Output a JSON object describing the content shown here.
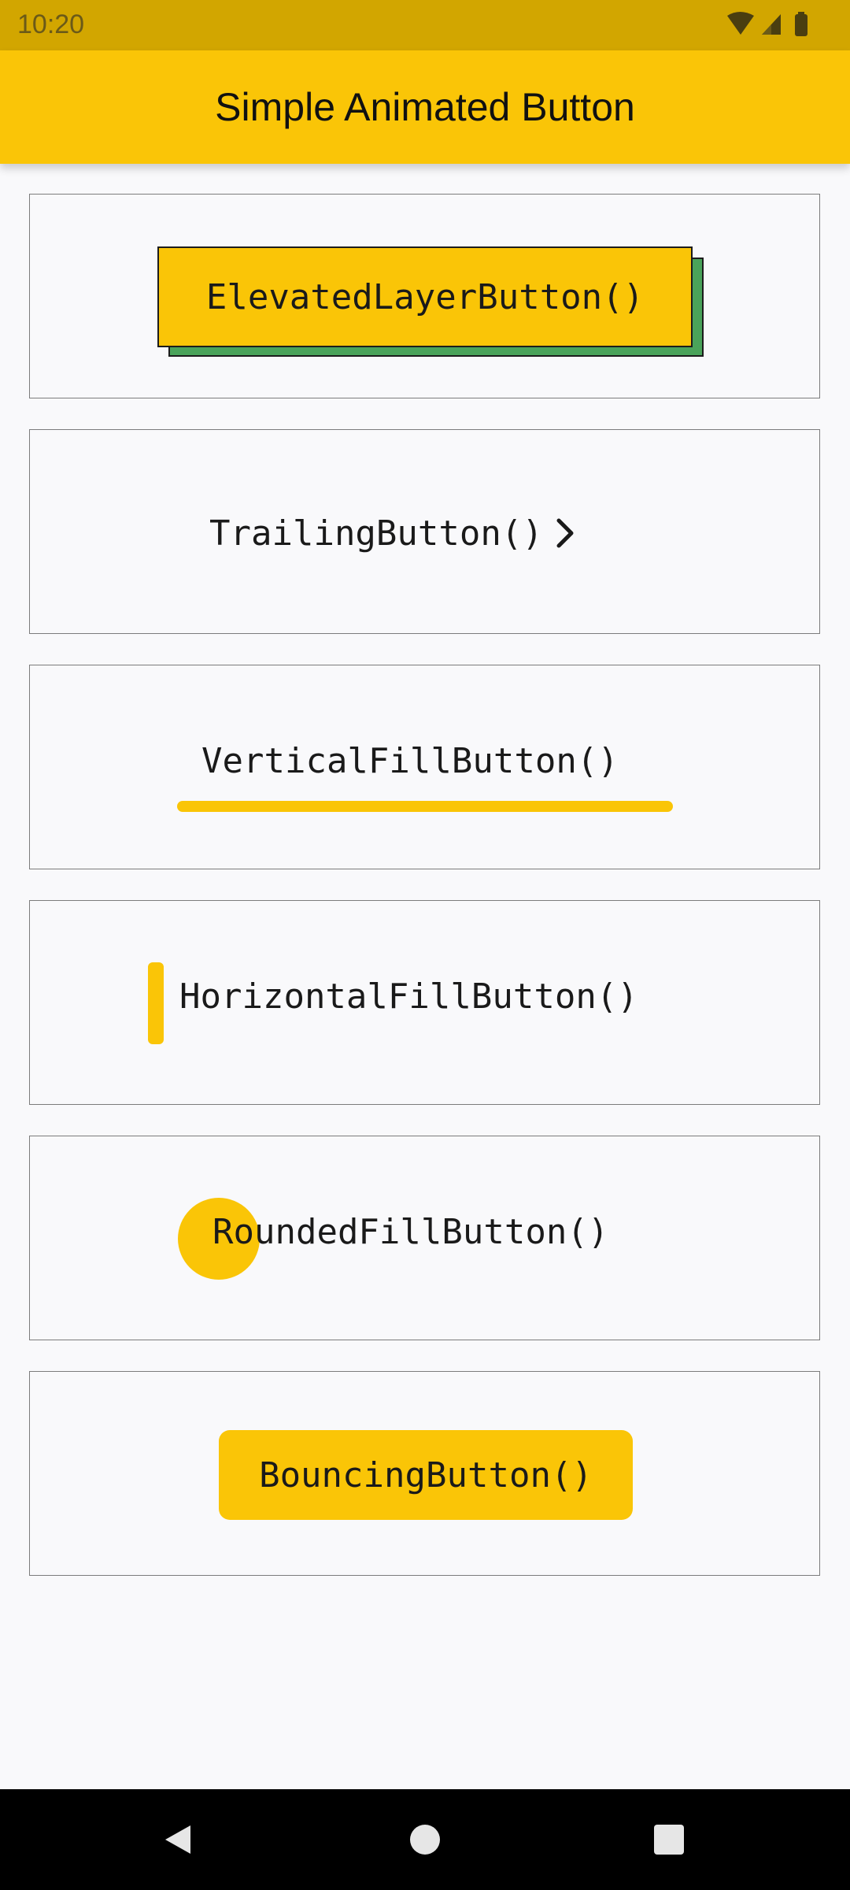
{
  "status_bar": {
    "time": "10:20",
    "icons": [
      "wifi-icon",
      "signal-icon",
      "battery-icon"
    ]
  },
  "app_bar": {
    "title": "Simple Animated Button"
  },
  "buttons": {
    "elevated_layer": "ElevatedLayerButton()",
    "trailing": "TrailingButton()",
    "vertical_fill": "VerticalFillButton()",
    "horizontal_fill": "HorizontalFillButton()",
    "rounded_fill": "RoundedFillButton()",
    "bouncing": "BouncingButton()"
  },
  "nav_bar": {
    "icons": [
      "back-icon",
      "home-icon",
      "recents-icon"
    ]
  },
  "colors": {
    "accent": "#fac507",
    "status_bar": "#d2a600",
    "layer_shadow": "#4aa35a",
    "background": "#f9f9fb",
    "card_border": "#7c7c7c"
  }
}
